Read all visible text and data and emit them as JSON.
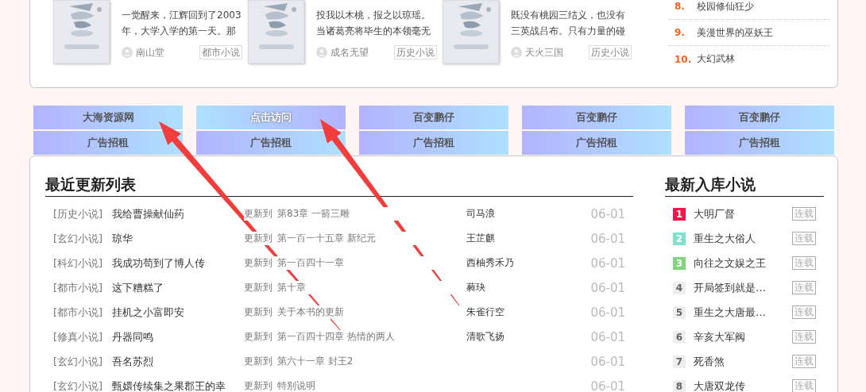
{
  "featured": [
    {
      "lines": [
        "一觉醒来，江辉回到了2003",
        "年，大学入学的第一天。那"
      ],
      "author": "南山堂",
      "genre": "都市小说"
    },
    {
      "lines": [
        "投我以木桃，报之以琼瑶。",
        "当诸葛亮将毕生的本领毫无"
      ],
      "author": "成名无望",
      "genre": "历史小说"
    },
    {
      "lines": [
        "既没有桃园三结义，也没有",
        "三英战吕布。只有力量的碰"
      ],
      "author": "天火三国",
      "genre": "历史小说"
    }
  ],
  "ranking": [
    {
      "rank": "8.",
      "title": "校园修仙狂少"
    },
    {
      "rank": "9.",
      "title": "美漫世界的巫妖王"
    },
    {
      "rank": "10.",
      "title": "大幻武林"
    }
  ],
  "ads": [
    {
      "label": "大海资源网",
      "highlight": false
    },
    {
      "label": "点击访问",
      "highlight": true
    },
    {
      "label": "百变鹏仔",
      "highlight": false
    },
    {
      "label": "百变鹏仔",
      "highlight": false
    },
    {
      "label": "百变鹏仔",
      "highlight": false
    },
    {
      "label": "广告招租",
      "highlight": false
    },
    {
      "label": "广告招租",
      "highlight": false
    },
    {
      "label": "广告招租",
      "highlight": false
    },
    {
      "label": "广告招租",
      "highlight": false
    },
    {
      "label": "广告招租",
      "highlight": false
    }
  ],
  "recent": {
    "title": "最近更新列表",
    "rows": [
      {
        "category": "[历史小说]",
        "title": "我给曹操献仙药",
        "update_label": "更新到",
        "chapter": "第83章 一箭三雕",
        "author": "司马浪",
        "date": "06-01"
      },
      {
        "category": "[玄幻小说]",
        "title": "琼华",
        "update_label": "更新到",
        "chapter": "第一百一十五章 新纪元",
        "author": "王芷麒",
        "date": "06-01"
      },
      {
        "category": "[科幻小说]",
        "title": "我成功苟到了博人传",
        "update_label": "更新到",
        "chapter": "第一百四十一章",
        "author": "西柚秀禾乃",
        "date": "06-01"
      },
      {
        "category": "[都市小说]",
        "title": "这下糟糕了",
        "update_label": "更新到",
        "chapter": "第十章",
        "author": "蕤玦",
        "date": "06-01"
      },
      {
        "category": "[都市小说]",
        "title": "挂机之小富即安",
        "update_label": "更新到",
        "chapter": "关于本书的更新",
        "author": "朱雀行空",
        "date": "06-01"
      },
      {
        "category": "[修真小说]",
        "title": "丹器同鸣",
        "update_label": "更新到",
        "chapter": "第一百四十四章 热情的两人",
        "author": "清歌飞扬",
        "date": "06-01"
      },
      {
        "category": "[玄幻小说]",
        "title": "吾名苏烈",
        "update_label": "更新到",
        "chapter": "第六十一章 封王2",
        "date": "06-01"
      },
      {
        "category": "[玄幻小说]",
        "title": "甄嬛传续集之果郡王的幸",
        "update_label": "更新到",
        "chapter": "特别说明",
        "date": "06-01"
      }
    ]
  },
  "latest": {
    "title": "最新入库小说",
    "items": [
      {
        "rank": "1",
        "color": "#f0174a",
        "title": "大明厂督",
        "status": "连载"
      },
      {
        "rank": "2",
        "color": "#7fe0d0",
        "title": "重生之大俗人",
        "status": "连载"
      },
      {
        "rank": "3",
        "color": "#7fd67f",
        "title": "向往之文娱之王",
        "status": "连载"
      },
      {
        "rank": "4",
        "color": "#eeeeee",
        "title": "开局签到就是…",
        "status": "连载"
      },
      {
        "rank": "5",
        "color": "#eeeeee",
        "title": "重生之大唐最…",
        "status": "连载"
      },
      {
        "rank": "6",
        "color": "#eeeeee",
        "title": "辛亥大军阀",
        "status": "连载"
      },
      {
        "rank": "7",
        "color": "#eeeeee",
        "title": "死香煞",
        "status": "连载"
      },
      {
        "rank": "8",
        "color": "#eeeeee",
        "title": "大唐双龙传",
        "status": "连载"
      }
    ]
  }
}
